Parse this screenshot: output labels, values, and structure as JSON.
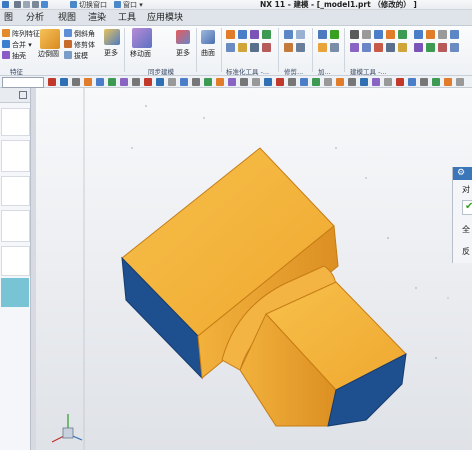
{
  "titlebar": {
    "switch_window": "切换窗口",
    "window": "窗口",
    "title": "NX 11 - 建模 - [_model1.prt （修改的） ]"
  },
  "menubar": {
    "items": [
      "图",
      "分析",
      "视图",
      "渲染",
      "工具",
      "应用模块"
    ]
  },
  "ribbon": {
    "small_left": [
      "阵列特征",
      "合并",
      "抽壳"
    ],
    "left_group": "特征",
    "draw_face": "边倒圆",
    "small_mid": [
      "倒斜角",
      "修剪体",
      "拔模"
    ],
    "more": "更多",
    "move_face": "移动面",
    "sync_group": "同步建模",
    "face": "曲面",
    "std_group": "标准化工具 -...",
    "adjust_group": "修剪...",
    "add_group": "加...",
    "build_group": "建模工具 -..."
  },
  "dialog": {
    "title_icon": "gear-icon",
    "line1": "对",
    "line2": "全",
    "line3": "反"
  },
  "colors": {
    "accent_blue": "#2f6fb3",
    "model_orange": "#f2b13c",
    "model_blue": "#1e4f8f",
    "check_green": "#38a020"
  }
}
